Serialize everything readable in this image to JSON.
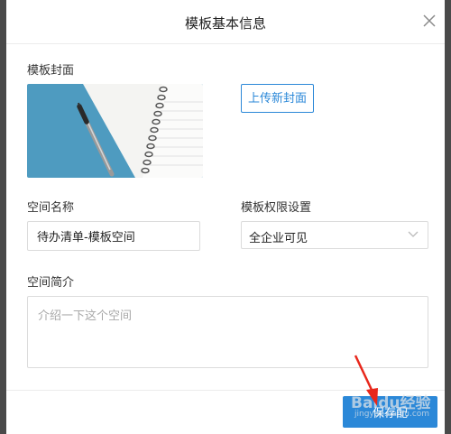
{
  "dialog": {
    "title": "模板基本信息",
    "close_icon": "close-icon"
  },
  "cover": {
    "label": "模板封面",
    "upload_label": "上传新封面",
    "image_description_icon": "notebook-pen-cover-image"
  },
  "space_name": {
    "label": "空间名称",
    "value": "待办清单-模板空间"
  },
  "permission": {
    "label": "模板权限设置",
    "value": "全企业可见",
    "icon": "chevron-down-icon"
  },
  "intro": {
    "label": "空间简介",
    "placeholder": "介绍一下这个空间",
    "value": ""
  },
  "footer": {
    "save_label": "保存配"
  },
  "watermark": {
    "main": "Baidu经验",
    "sub": "jingyan.baidu.com"
  },
  "colors": {
    "accent": "#2b88d8",
    "cover_bg": "#4e9bc0",
    "arrow": "#e8271b"
  }
}
